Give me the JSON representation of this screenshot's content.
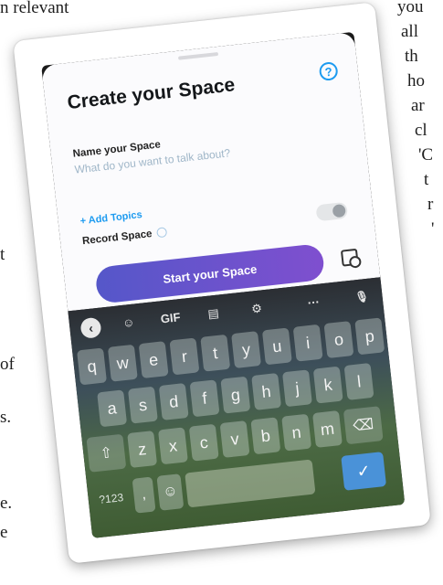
{
  "background_text": {
    "top_left": "n relevant",
    "left_fragments": [
      "t",
      "of",
      "s.",
      "e.",
      "e"
    ],
    "right_fragments": [
      "you",
      "all",
      "th",
      "ho",
      "ar",
      "cl",
      "'C",
      "t",
      "r",
      "'"
    ]
  },
  "sheet": {
    "title": "Create your Space",
    "help_icon_glyph": "?",
    "name_label": "Name your Space",
    "name_placeholder": "What do you want to talk about?",
    "add_topics_label": "+ Add Topics",
    "record_label": "Record Space",
    "record_toggle_on": false,
    "start_button_label": "Start your Space",
    "accent_color": "#1d9bf0"
  },
  "keyboard": {
    "toolbar": {
      "back": "‹",
      "sticker": "☺",
      "gif": "GIF",
      "clipboard": "▤",
      "settings": "⚙",
      "more": "···",
      "mic": "🎙"
    },
    "row1": [
      "q",
      "w",
      "e",
      "r",
      "t",
      "y",
      "u",
      "i",
      "o",
      "p"
    ],
    "row2": [
      "a",
      "s",
      "d",
      "f",
      "g",
      "h",
      "j",
      "k",
      "l"
    ],
    "row3": [
      "z",
      "x",
      "c",
      "v",
      "b",
      "n",
      "m"
    ],
    "shift": "⇧",
    "backspace": "⌫",
    "symbols_label": "?123",
    "comma": ",",
    "emoji": "☺",
    "enter": "✓"
  }
}
